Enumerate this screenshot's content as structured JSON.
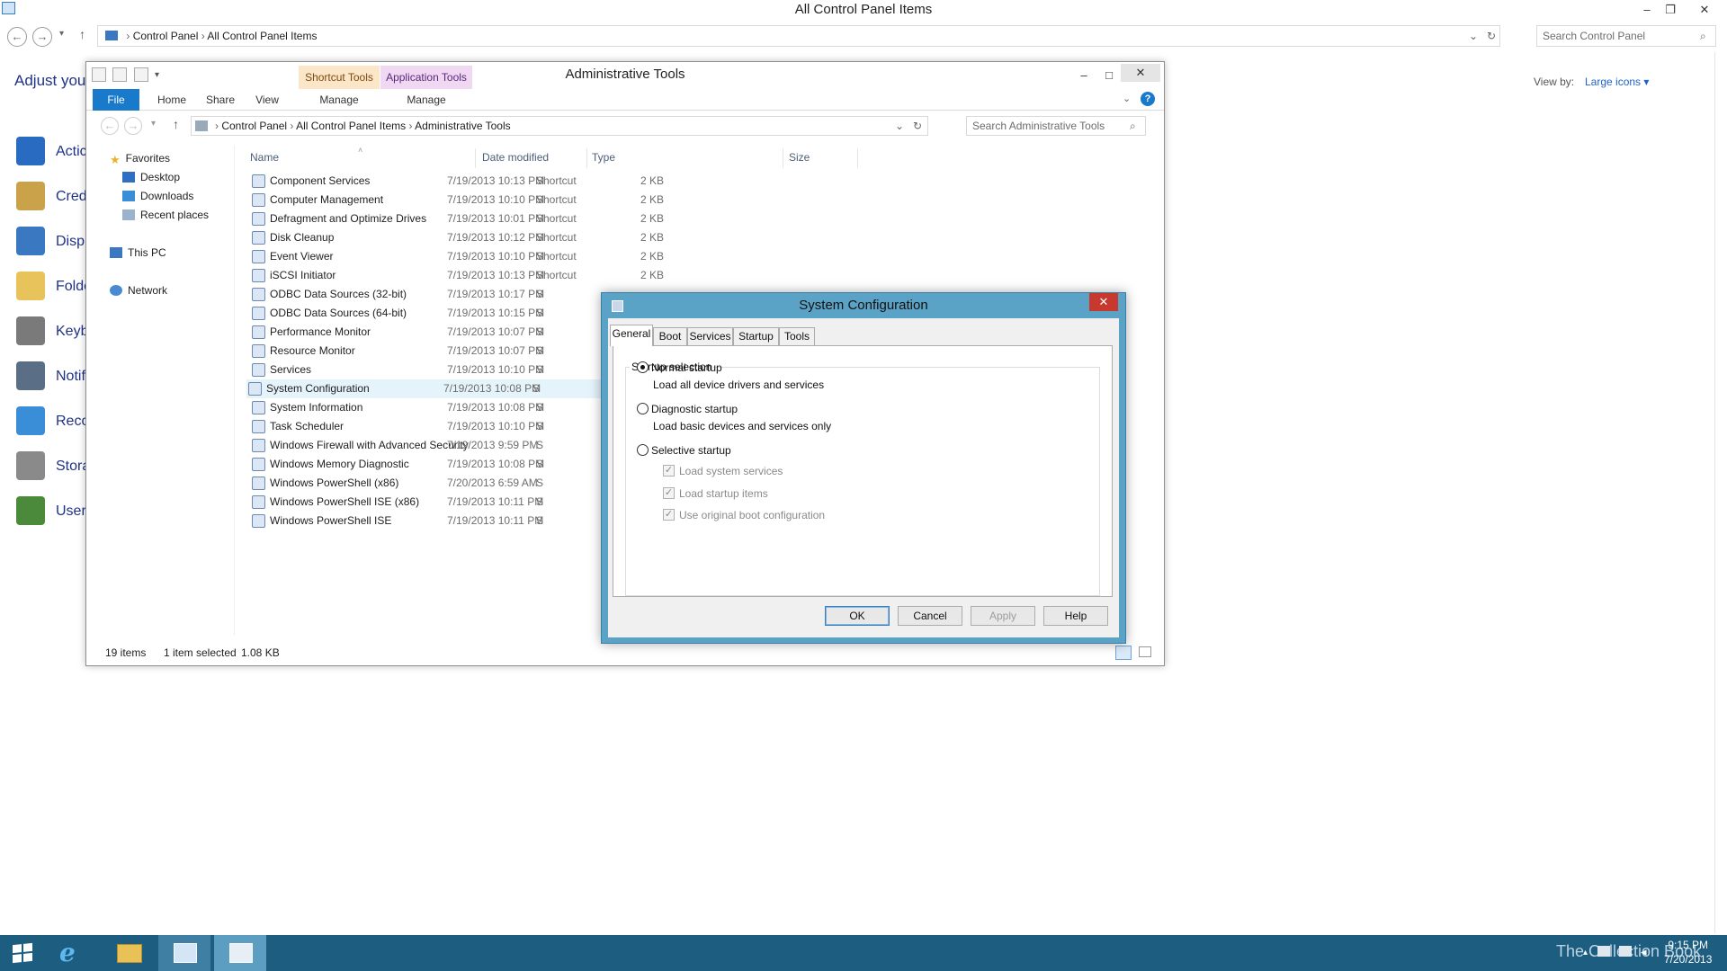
{
  "control_panel": {
    "title": "All Control Panel Items",
    "breadcrumb": [
      "Control Panel",
      "All Control Panel Items"
    ],
    "search_placeholder": "Search Control Panel",
    "heading": "Adjust your",
    "view_by_label": "View by:",
    "view_by_value": "Large icons",
    "items": [
      {
        "label": "Actic",
        "icon": "flag-icon",
        "color": "#2a6bc2"
      },
      {
        "label": "Cred",
        "icon": "credential-vault-icon",
        "color": "#c9a24a"
      },
      {
        "label": "Displ",
        "icon": "monitor-icon",
        "color": "#3a78c2"
      },
      {
        "label": "Folde",
        "icon": "folder-icon",
        "color": "#e8c25a"
      },
      {
        "label": "Keyb",
        "icon": "keyboard-icon",
        "color": "#7a7a7a"
      },
      {
        "label": "Notif",
        "icon": "notification-icon",
        "color": "#5a6e86"
      },
      {
        "label": "Reco",
        "icon": "recovery-icon",
        "color": "#3a8ed8"
      },
      {
        "label": "Stora",
        "icon": "storage-icon",
        "color": "#8a8a8a"
      },
      {
        "label": "User",
        "icon": "users-icon",
        "color": "#4a8a3a"
      }
    ]
  },
  "explorer": {
    "title": "Administrative Tools",
    "context_tabs": [
      {
        "group": "Shortcut Tools",
        "tab": "Manage"
      },
      {
        "group": "Application Tools",
        "tab": "Manage"
      }
    ],
    "ribbon_tabs": [
      "File",
      "Home",
      "Share",
      "View"
    ],
    "breadcrumb": [
      "Control Panel",
      "All Control Panel Items",
      "Administrative Tools"
    ],
    "search_placeholder": "Search Administrative Tools",
    "nav_pane": {
      "favorites": "Favorites",
      "favorites_items": [
        "Desktop",
        "Downloads",
        "Recent places"
      ],
      "this_pc": "This PC",
      "network": "Network"
    },
    "columns": [
      "Name",
      "Date modified",
      "Type",
      "Size"
    ],
    "files": [
      {
        "name": "Component Services",
        "date": "7/19/2013 10:13 PM",
        "type": "Shortcut",
        "size": "2 KB"
      },
      {
        "name": "Computer Management",
        "date": "7/19/2013 10:10 PM",
        "type": "Shortcut",
        "size": "2 KB"
      },
      {
        "name": "Defragment and Optimize Drives",
        "date": "7/19/2013 10:01 PM",
        "type": "Shortcut",
        "size": "2 KB"
      },
      {
        "name": "Disk Cleanup",
        "date": "7/19/2013 10:12 PM",
        "type": "Shortcut",
        "size": "2 KB"
      },
      {
        "name": "Event Viewer",
        "date": "7/19/2013 10:10 PM",
        "type": "Shortcut",
        "size": "2 KB"
      },
      {
        "name": "iSCSI Initiator",
        "date": "7/19/2013 10:13 PM",
        "type": "Shortcut",
        "size": "2 KB"
      },
      {
        "name": "ODBC Data Sources (32-bit)",
        "date": "7/19/2013 10:17 PM",
        "type": "S",
        "size": ""
      },
      {
        "name": "ODBC Data Sources (64-bit)",
        "date": "7/19/2013 10:15 PM",
        "type": "S",
        "size": ""
      },
      {
        "name": "Performance Monitor",
        "date": "7/19/2013 10:07 PM",
        "type": "S",
        "size": ""
      },
      {
        "name": "Resource Monitor",
        "date": "7/19/2013 10:07 PM",
        "type": "S",
        "size": ""
      },
      {
        "name": "Services",
        "date": "7/19/2013 10:10 PM",
        "type": "S",
        "size": ""
      },
      {
        "name": "System Configuration",
        "date": "7/19/2013 10:08 PM",
        "type": "S",
        "size": ""
      },
      {
        "name": "System Information",
        "date": "7/19/2013 10:08 PM",
        "type": "S",
        "size": ""
      },
      {
        "name": "Task Scheduler",
        "date": "7/19/2013 10:10 PM",
        "type": "S",
        "size": ""
      },
      {
        "name": "Windows Firewall with Advanced Security",
        "date": "7/19/2013 9:59 PM",
        "type": "S",
        "size": ""
      },
      {
        "name": "Windows Memory Diagnostic",
        "date": "7/19/2013 10:08 PM",
        "type": "S",
        "size": ""
      },
      {
        "name": "Windows PowerShell (x86)",
        "date": "7/20/2013 6:59 AM",
        "type": "S",
        "size": ""
      },
      {
        "name": "Windows PowerShell ISE (x86)",
        "date": "7/19/2013 10:11 PM",
        "type": "S",
        "size": ""
      },
      {
        "name": "Windows PowerShell ISE",
        "date": "7/19/2013 10:11 PM",
        "type": "S",
        "size": ""
      }
    ],
    "selected_index": 11,
    "status": {
      "count": "19 items",
      "selection": "1 item selected",
      "size": "1.08 KB"
    }
  },
  "dialog": {
    "title": "System Configuration",
    "tabs": [
      "General",
      "Boot",
      "Services",
      "Startup",
      "Tools"
    ],
    "active_tab": "General",
    "group_label": "Startup selection",
    "options": [
      {
        "label": "Normal startup",
        "desc": "Load all device drivers and services",
        "selected": true
      },
      {
        "label": "Diagnostic startup",
        "desc": "Load basic devices and services only",
        "selected": false
      },
      {
        "label": "Selective startup",
        "desc": "",
        "selected": false
      }
    ],
    "checkboxes": [
      {
        "label": "Load system services",
        "checked": true
      },
      {
        "label": "Load startup items",
        "checked": true
      },
      {
        "label": "Use original boot configuration",
        "checked": true
      }
    ],
    "buttons": [
      "OK",
      "Cancel",
      "Apply",
      "Help"
    ]
  },
  "taskbar": {
    "time": "9:15 PM",
    "date": "7/20/2013",
    "watermark": "The Collection Book",
    "accent": "#1c5d80"
  }
}
